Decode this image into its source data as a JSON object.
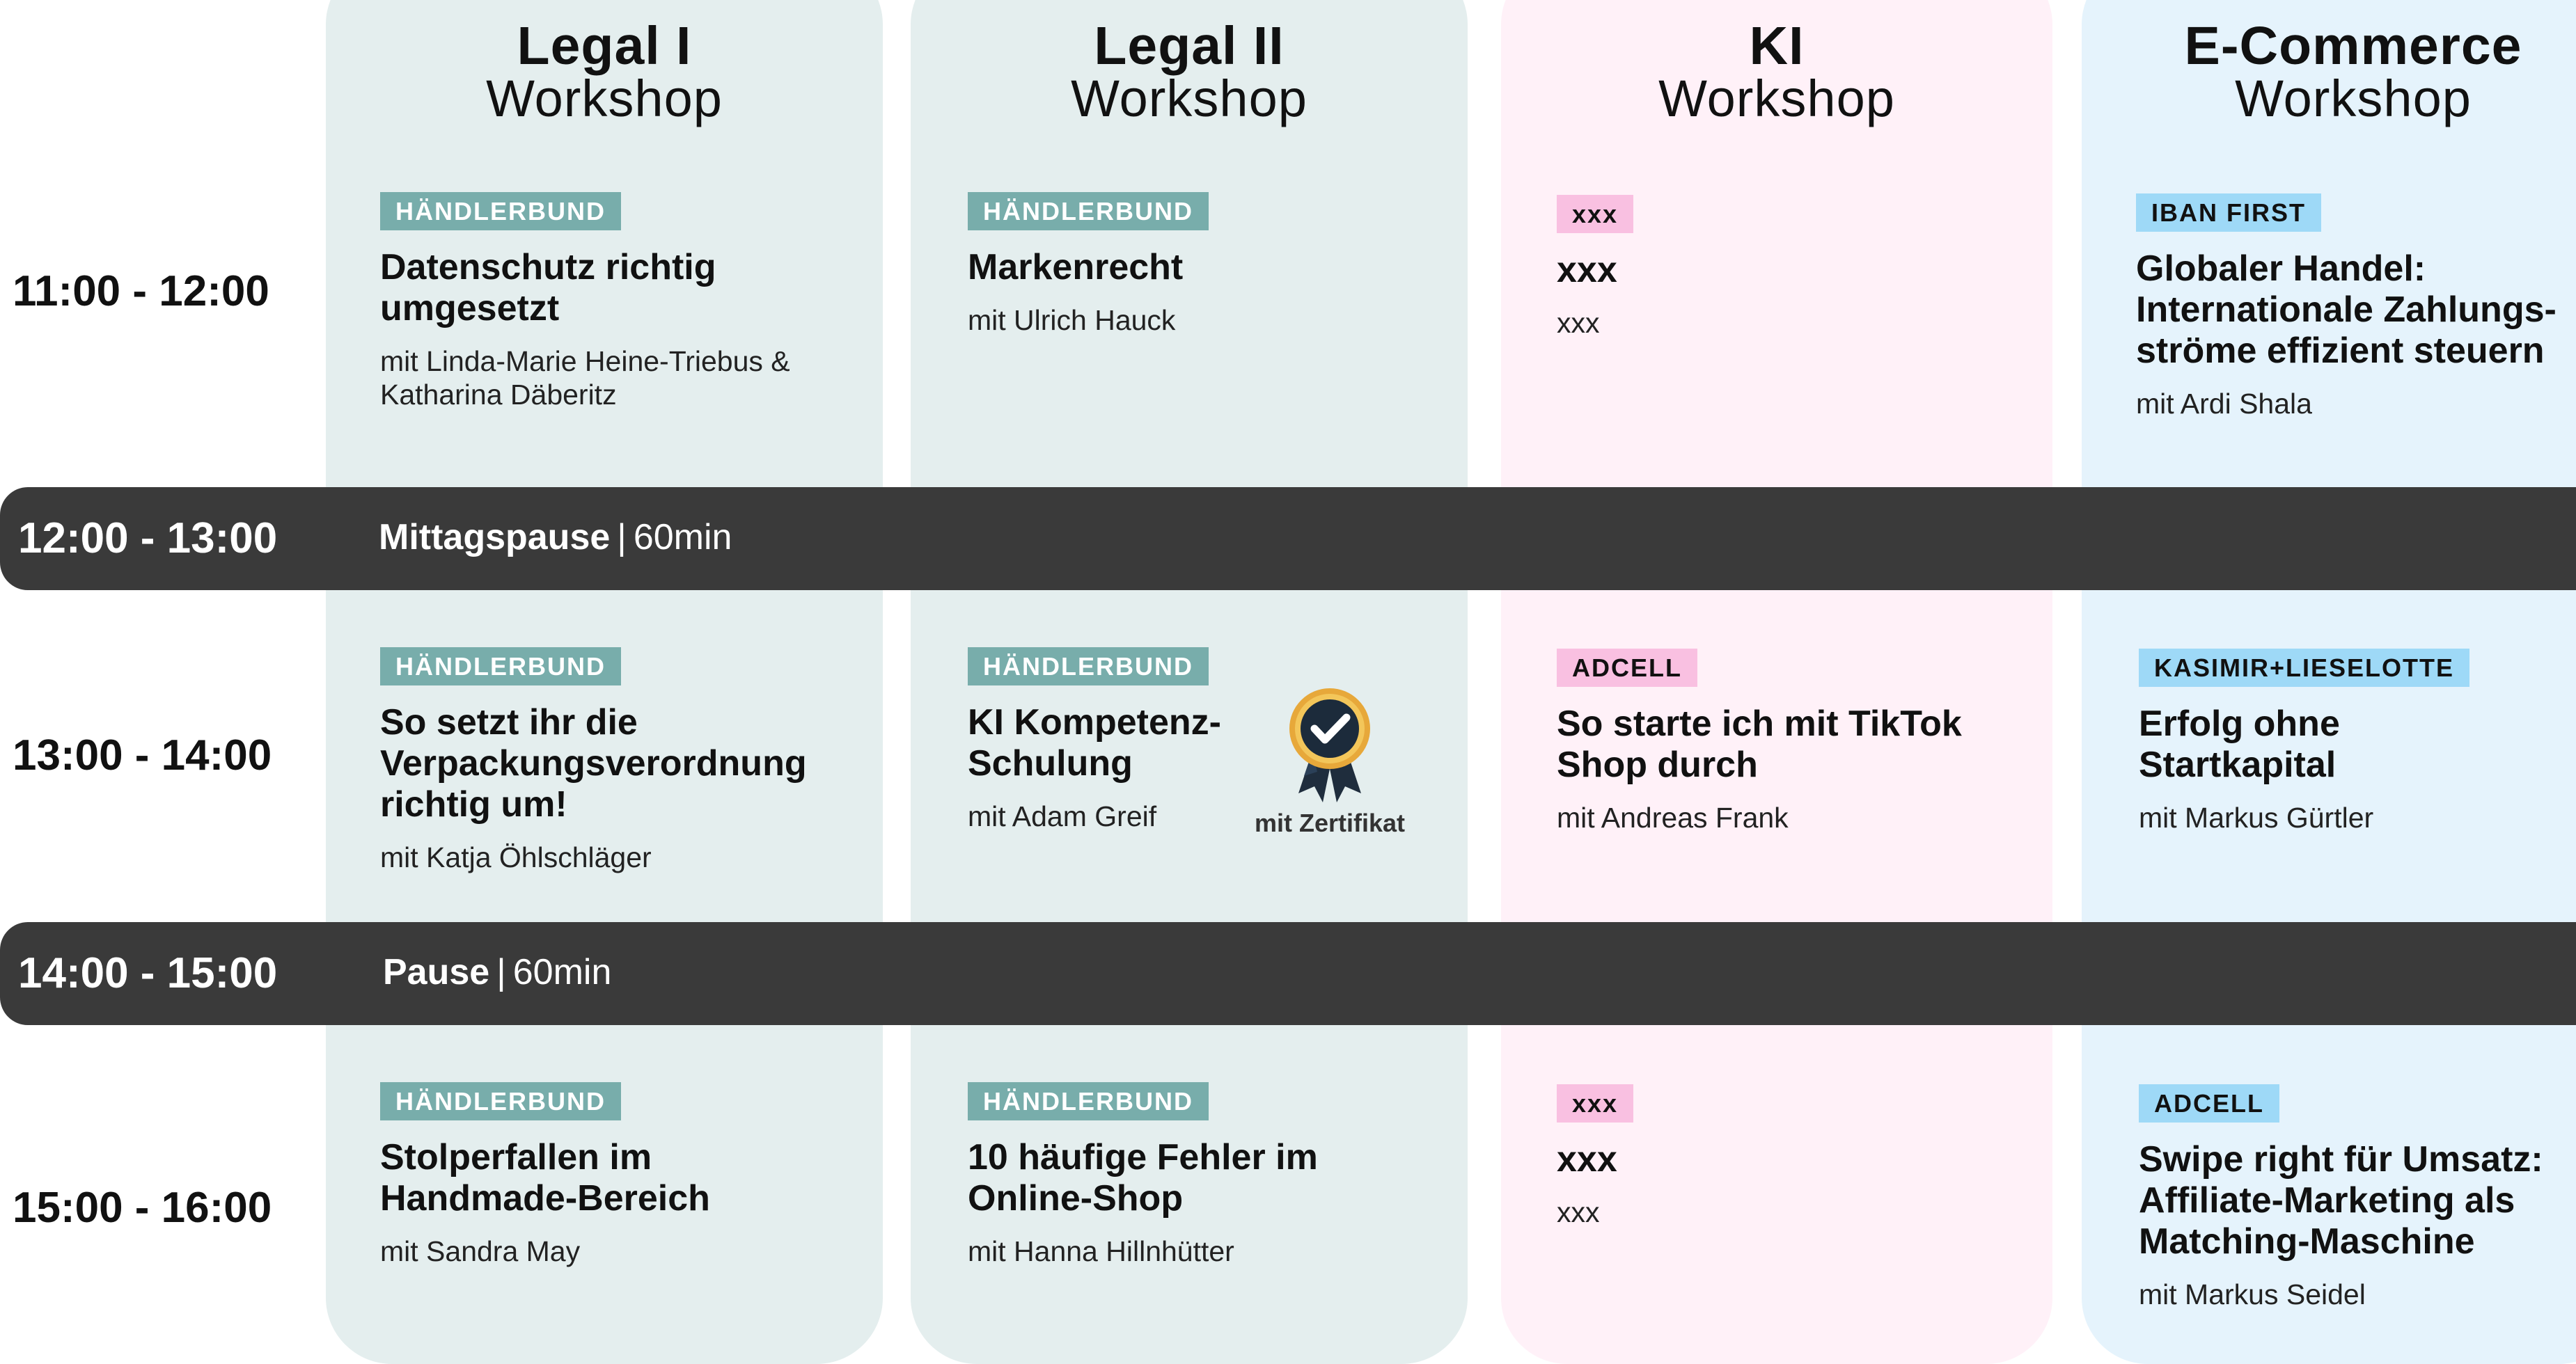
{
  "columns": [
    {
      "title": "Legal I",
      "subtitle": "Workshop",
      "color": "#e4eeee"
    },
    {
      "title": "Legal II",
      "subtitle": "Workshop",
      "color": "#e4eeee"
    },
    {
      "title": "KI",
      "subtitle": "Workshop",
      "color": "#fff1f8"
    },
    {
      "title": "E-Commerce",
      "subtitle": "Workshop",
      "color": "#e5f3fc"
    }
  ],
  "times": {
    "slot1": "11:00 - 12:00",
    "slot2": "13:00 - 14:00",
    "slot3": "15:00 - 16:00"
  },
  "breaks": [
    {
      "time": "12:00 - 13:00",
      "title": "Mittagspause",
      "separator": "|",
      "duration": "60min"
    },
    {
      "time": "14:00 - 15:00",
      "title": "Pause",
      "separator": "|",
      "duration": "60min"
    }
  ],
  "sessions": {
    "s11": {
      "tag": "HÄNDLERBUND",
      "title": "Datenschutz richtig umgesetzt",
      "speaker": "mit Linda-Marie Heine-Triebus & Katharina Däberitz"
    },
    "s12": {
      "tag": "HÄNDLERBUND",
      "title": "Markenrecht",
      "speaker": "mit Ulrich Hauck"
    },
    "s13": {
      "tag": "xxx",
      "title": "xxx",
      "speaker": "xxx"
    },
    "s14": {
      "tag": "IBAN FIRST",
      "title": "Globaler Handel: Internationale Zahlungs-ströme effizient steuern",
      "speaker": "mit Ardi Shala"
    },
    "s21": {
      "tag": "HÄNDLERBUND",
      "title": "So setzt ihr die Verpackungsverordnung richtig um!",
      "speaker": "mit Katja Öhlschläger"
    },
    "s22": {
      "tag": "HÄNDLERBUND",
      "title": "KI Kompetenz-Schulung",
      "speaker": "mit Adam Greif",
      "certificate": "mit Zertifikat"
    },
    "s23": {
      "tag": "ADCELL",
      "title": "So starte ich mit TikTok Shop durch",
      "speaker": "mit Andreas Frank"
    },
    "s24": {
      "tag": "KASIMIR+LIESELOTTE",
      "title": "Erfolg ohne Startkapital",
      "speaker": "mit Markus Gürtler"
    },
    "s31": {
      "tag": "HÄNDLERBUND",
      "title": "Stolperfallen im Handmade-Bereich",
      "speaker": "mit Sandra May"
    },
    "s32": {
      "tag": "HÄNDLERBUND",
      "title": "10 häufige Fehler im Online-Shop",
      "speaker": "mit Hanna Hillnhütter"
    },
    "s33": {
      "tag": "xxx",
      "title": "xxx",
      "speaker": "xxx"
    },
    "s34": {
      "tag": "ADCELL",
      "title": "Swipe right für Umsatz: Affiliate-Marketing als Matching-Maschine",
      "speaker": "mit Markus Seidel"
    }
  },
  "icons": {
    "certificate": "award-badge-checkmark-icon"
  },
  "colors": {
    "band": "#3a3a3a",
    "tag_haendlerbund": "#78adab",
    "tag_pink": "#f9c0e1",
    "tag_blue": "#9ed9f7"
  }
}
